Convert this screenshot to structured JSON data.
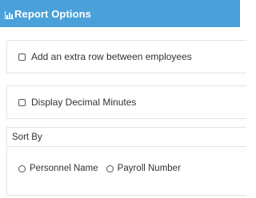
{
  "header": {
    "title": "Report Options",
    "icon": "bar-chart-icon",
    "color": "#4aa0d8"
  },
  "options": {
    "extra_row": {
      "label": "Add an extra row between employees",
      "checked": false
    },
    "decimal_minutes": {
      "label": "Display Decimal Minutes",
      "checked": false
    }
  },
  "sort_by": {
    "title": "Sort By",
    "options": [
      {
        "label": "Personnel Name",
        "selected": false
      },
      {
        "label": "Payroll Number",
        "selected": false
      }
    ]
  }
}
